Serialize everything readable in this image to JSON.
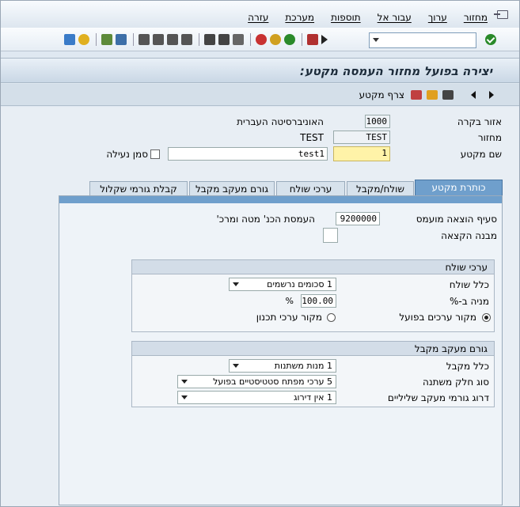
{
  "menu": {
    "items": [
      "מחזור",
      "ערוך",
      "עבור אל",
      "תוספות",
      "מערכת",
      "עזרה"
    ]
  },
  "toolbar": {
    "command_field_value": "",
    "icons": [
      "enter-icon",
      "save-icon",
      "back-icon",
      "exit-icon",
      "cancel-icon",
      "print-icon",
      "find-icon",
      "find-next-icon",
      "first-page-icon",
      "previous-page-icon",
      "next-page-icon",
      "last-page-icon",
      "new-session-icon",
      "shortcut-icon",
      "help-icon",
      "layout-icon"
    ]
  },
  "title": "יצירה בפועל מחזור העמסה מקטע:",
  "app_toolbar": {
    "attach_label": "צרף מקטע"
  },
  "header": {
    "controlling_area_label": "אזור בקרה",
    "controlling_area_value": "1000",
    "controlling_area_text": "האוניברסיטה העברית",
    "cycle_label": "מחזור",
    "cycle_value": "TEST",
    "cycle_text": "TEST",
    "segment_name_label": "שם מקטע",
    "segment_name_value": "1",
    "segment_text_value": "test1",
    "lock_label": "סמן נעילה"
  },
  "tabs": [
    "כותרת מקטע",
    "שולח/מקבל",
    "ערכי שולח",
    "גורם מעקב מקבל",
    "קבלת גורמי שקלול"
  ],
  "segment_header": {
    "cost_element_label": "סעיף הוצאה מועמס",
    "cost_element_value": "9200000",
    "cost_element_text": "העמסת הכנ' מטה ומרכ'",
    "cost_structure_label": "מבנה הקצאה",
    "cost_structure_value": ""
  },
  "sender_values": {
    "title": "ערכי שולח",
    "rule_label": "כלל שולח",
    "rule_value": "1 סכומים נרשמים",
    "share_label": "מניה ב-%",
    "share_value": "100.00",
    "share_unit": "%",
    "actual_source_label": "מקור ערכים בפועל",
    "plan_source_label": "מקור ערכי תכנון"
  },
  "receiver_tracing": {
    "title": "גורם מעקב מקבל",
    "rule_label": "כלל מקבל",
    "rule_value": "1 מנות משתנות",
    "var_type_label": "סוג חלק משתנה",
    "var_type_value": "5 ערכי מפתח סטטיסטיים בפועל",
    "scaling_label": "דרוג גורמי מעקב שליליים",
    "scaling_value": "1 אין דירוג"
  }
}
